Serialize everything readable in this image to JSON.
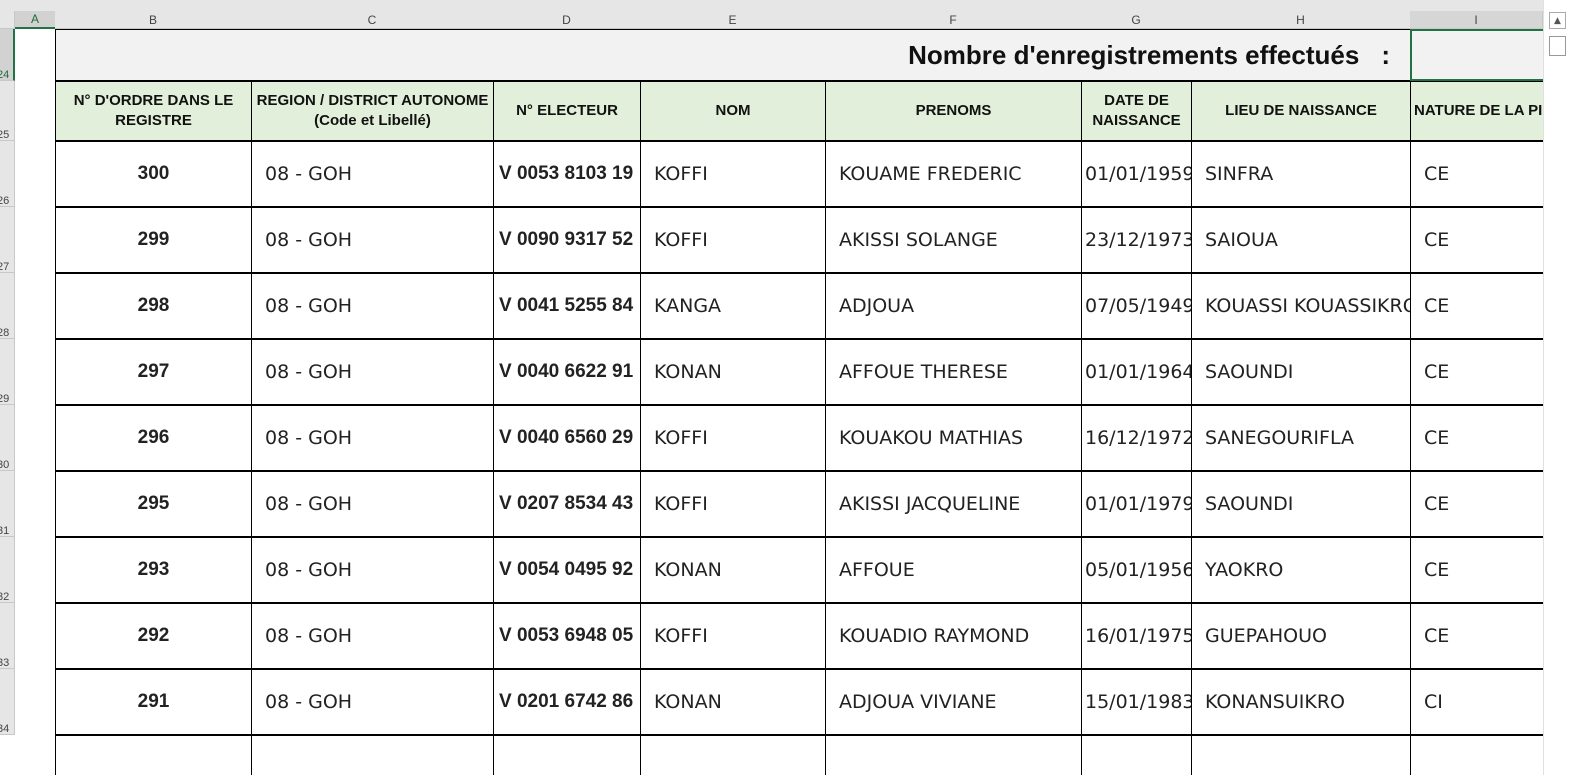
{
  "columns": [
    "A",
    "B",
    "C",
    "D",
    "E",
    "F",
    "G",
    "H",
    "I"
  ],
  "rows": [
    "24",
    "25",
    "26",
    "27",
    "28",
    "29",
    "30",
    "31",
    "32",
    "33",
    "34"
  ],
  "title": {
    "text": "Nombre d'enregistrements effectués",
    "colon": ":"
  },
  "headers": {
    "ordre": "N° D'ORDRE DANS LE\nREGISTRE",
    "region": "REGION / DISTRICT AUTONOME\n(Code et Libellé)",
    "electeur": "N° ELECTEUR",
    "nom": "NOM",
    "prenoms": "PRENOMS",
    "date": "DATE DE\nNAISSANCE",
    "lieu": "LIEU DE NAISSANCE",
    "nature": "NATURE DE LA PIE"
  },
  "records": [
    {
      "ordre": "300",
      "region": "08 - GOH",
      "electeur": "V 0053 8103 19",
      "nom": "KOFFI",
      "prenoms": "KOUAME FREDERIC",
      "date": "01/01/1959",
      "lieu": "SINFRA",
      "nature": "CE"
    },
    {
      "ordre": "299",
      "region": "08 - GOH",
      "electeur": "V 0090 9317 52",
      "nom": "KOFFI",
      "prenoms": "AKISSI SOLANGE",
      "date": "23/12/1973",
      "lieu": "SAIOUA",
      "nature": "CE"
    },
    {
      "ordre": "298",
      "region": "08 - GOH",
      "electeur": "V 0041 5255 84",
      "nom": "KANGA",
      "prenoms": "ADJOUA",
      "date": "07/05/1949",
      "lieu": "KOUASSI KOUASSIKRO",
      "nature": "CE"
    },
    {
      "ordre": "297",
      "region": "08 - GOH",
      "electeur": "V 0040 6622 91",
      "nom": "KONAN",
      "prenoms": "AFFOUE THERESE",
      "date": "01/01/1964",
      "lieu": "SAOUNDI",
      "nature": "CE"
    },
    {
      "ordre": "296",
      "region": "08 - GOH",
      "electeur": "V 0040 6560 29",
      "nom": "KOFFI",
      "prenoms": "KOUAKOU MATHIAS",
      "date": "16/12/1972",
      "lieu": "SANEGOURIFLA",
      "nature": "CE"
    },
    {
      "ordre": "295",
      "region": "08 - GOH",
      "electeur": "V 0207 8534 43",
      "nom": "KOFFI",
      "prenoms": "AKISSI JACQUELINE",
      "date": "01/01/1979",
      "lieu": "SAOUNDI",
      "nature": "CE"
    },
    {
      "ordre": "293",
      "region": "08 - GOH",
      "electeur": "V 0054 0495 92",
      "nom": "KONAN",
      "prenoms": "AFFOUE",
      "date": "05/01/1956",
      "lieu": "YAOKRO",
      "nature": "CE"
    },
    {
      "ordre": "292",
      "region": "08 - GOH",
      "electeur": "V 0053 6948 05",
      "nom": "KOFFI",
      "prenoms": "KOUADIO RAYMOND",
      "date": "16/01/1975",
      "lieu": "GUEPAHOUO",
      "nature": "CE"
    },
    {
      "ordre": "291",
      "region": "08 - GOH",
      "electeur": "V 0201 6742 86",
      "nom": "KONAN",
      "prenoms": "ADJOUA VIVIANE",
      "date": "15/01/1983",
      "lieu": "KONANSUIKRO",
      "nature": "CI"
    }
  ],
  "colors": {
    "header_fill": "#e2efda",
    "title_fill": "#f2f2f2",
    "selection": "#217346"
  },
  "icons": {
    "scroll_up": "triangle-up-icon"
  }
}
